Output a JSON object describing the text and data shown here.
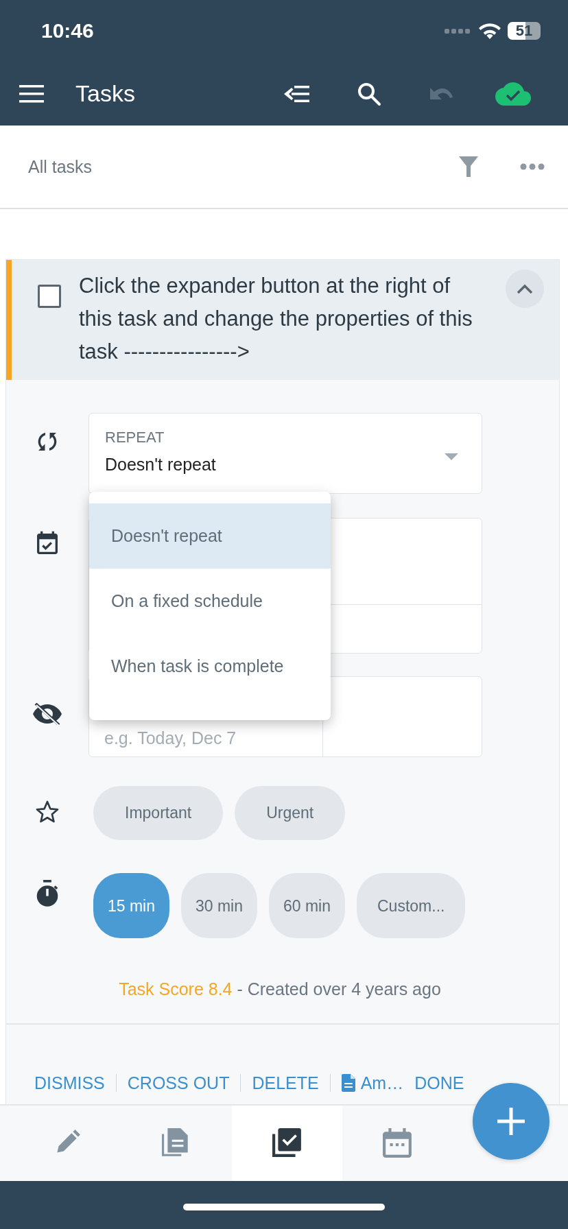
{
  "status_bar": {
    "time": "10:46",
    "battery": "51"
  },
  "toolbar": {
    "title": "Tasks",
    "undo_disabled": true
  },
  "filter_bar": {
    "label": "All tasks"
  },
  "task": {
    "text": "Click the expander button at the right of this task and change the properties of this task ---------------->",
    "checked": false,
    "expanded": true
  },
  "repeat_field": {
    "label": "REPEAT",
    "value": "Doesn't repeat"
  },
  "repeat_menu": [
    {
      "label": "Doesn't repeat",
      "selected": true
    },
    {
      "label": "On a fixed schedule",
      "selected": false
    },
    {
      "label": "When task is complete",
      "selected": false
    }
  ],
  "hide_field": {
    "placeholder": "e.g. Today, Dec 7"
  },
  "priority_chips": [
    {
      "label": "Important",
      "selected": false
    },
    {
      "label": "Urgent",
      "selected": false
    }
  ],
  "duration_chips": [
    {
      "label": "15 min",
      "selected": true
    },
    {
      "label": "30 min",
      "selected": false
    },
    {
      "label": "60 min",
      "selected": false
    },
    {
      "label": "Custom...",
      "selected": false
    }
  ],
  "score": {
    "score": "Task Score 8.4",
    "created": "- Created over 4 years ago"
  },
  "actions": [
    {
      "label": "DISMISS",
      "kind": "text"
    },
    {
      "label": "CROSS OUT",
      "kind": "text"
    },
    {
      "label": "DELETE",
      "kind": "text"
    },
    {
      "label": "Am…",
      "kind": "document"
    },
    {
      "label": "DONE",
      "kind": "text"
    }
  ],
  "bottom_nav": [
    {
      "selected": false
    },
    {
      "selected": false
    },
    {
      "selected": true
    },
    {
      "selected": false
    }
  ]
}
